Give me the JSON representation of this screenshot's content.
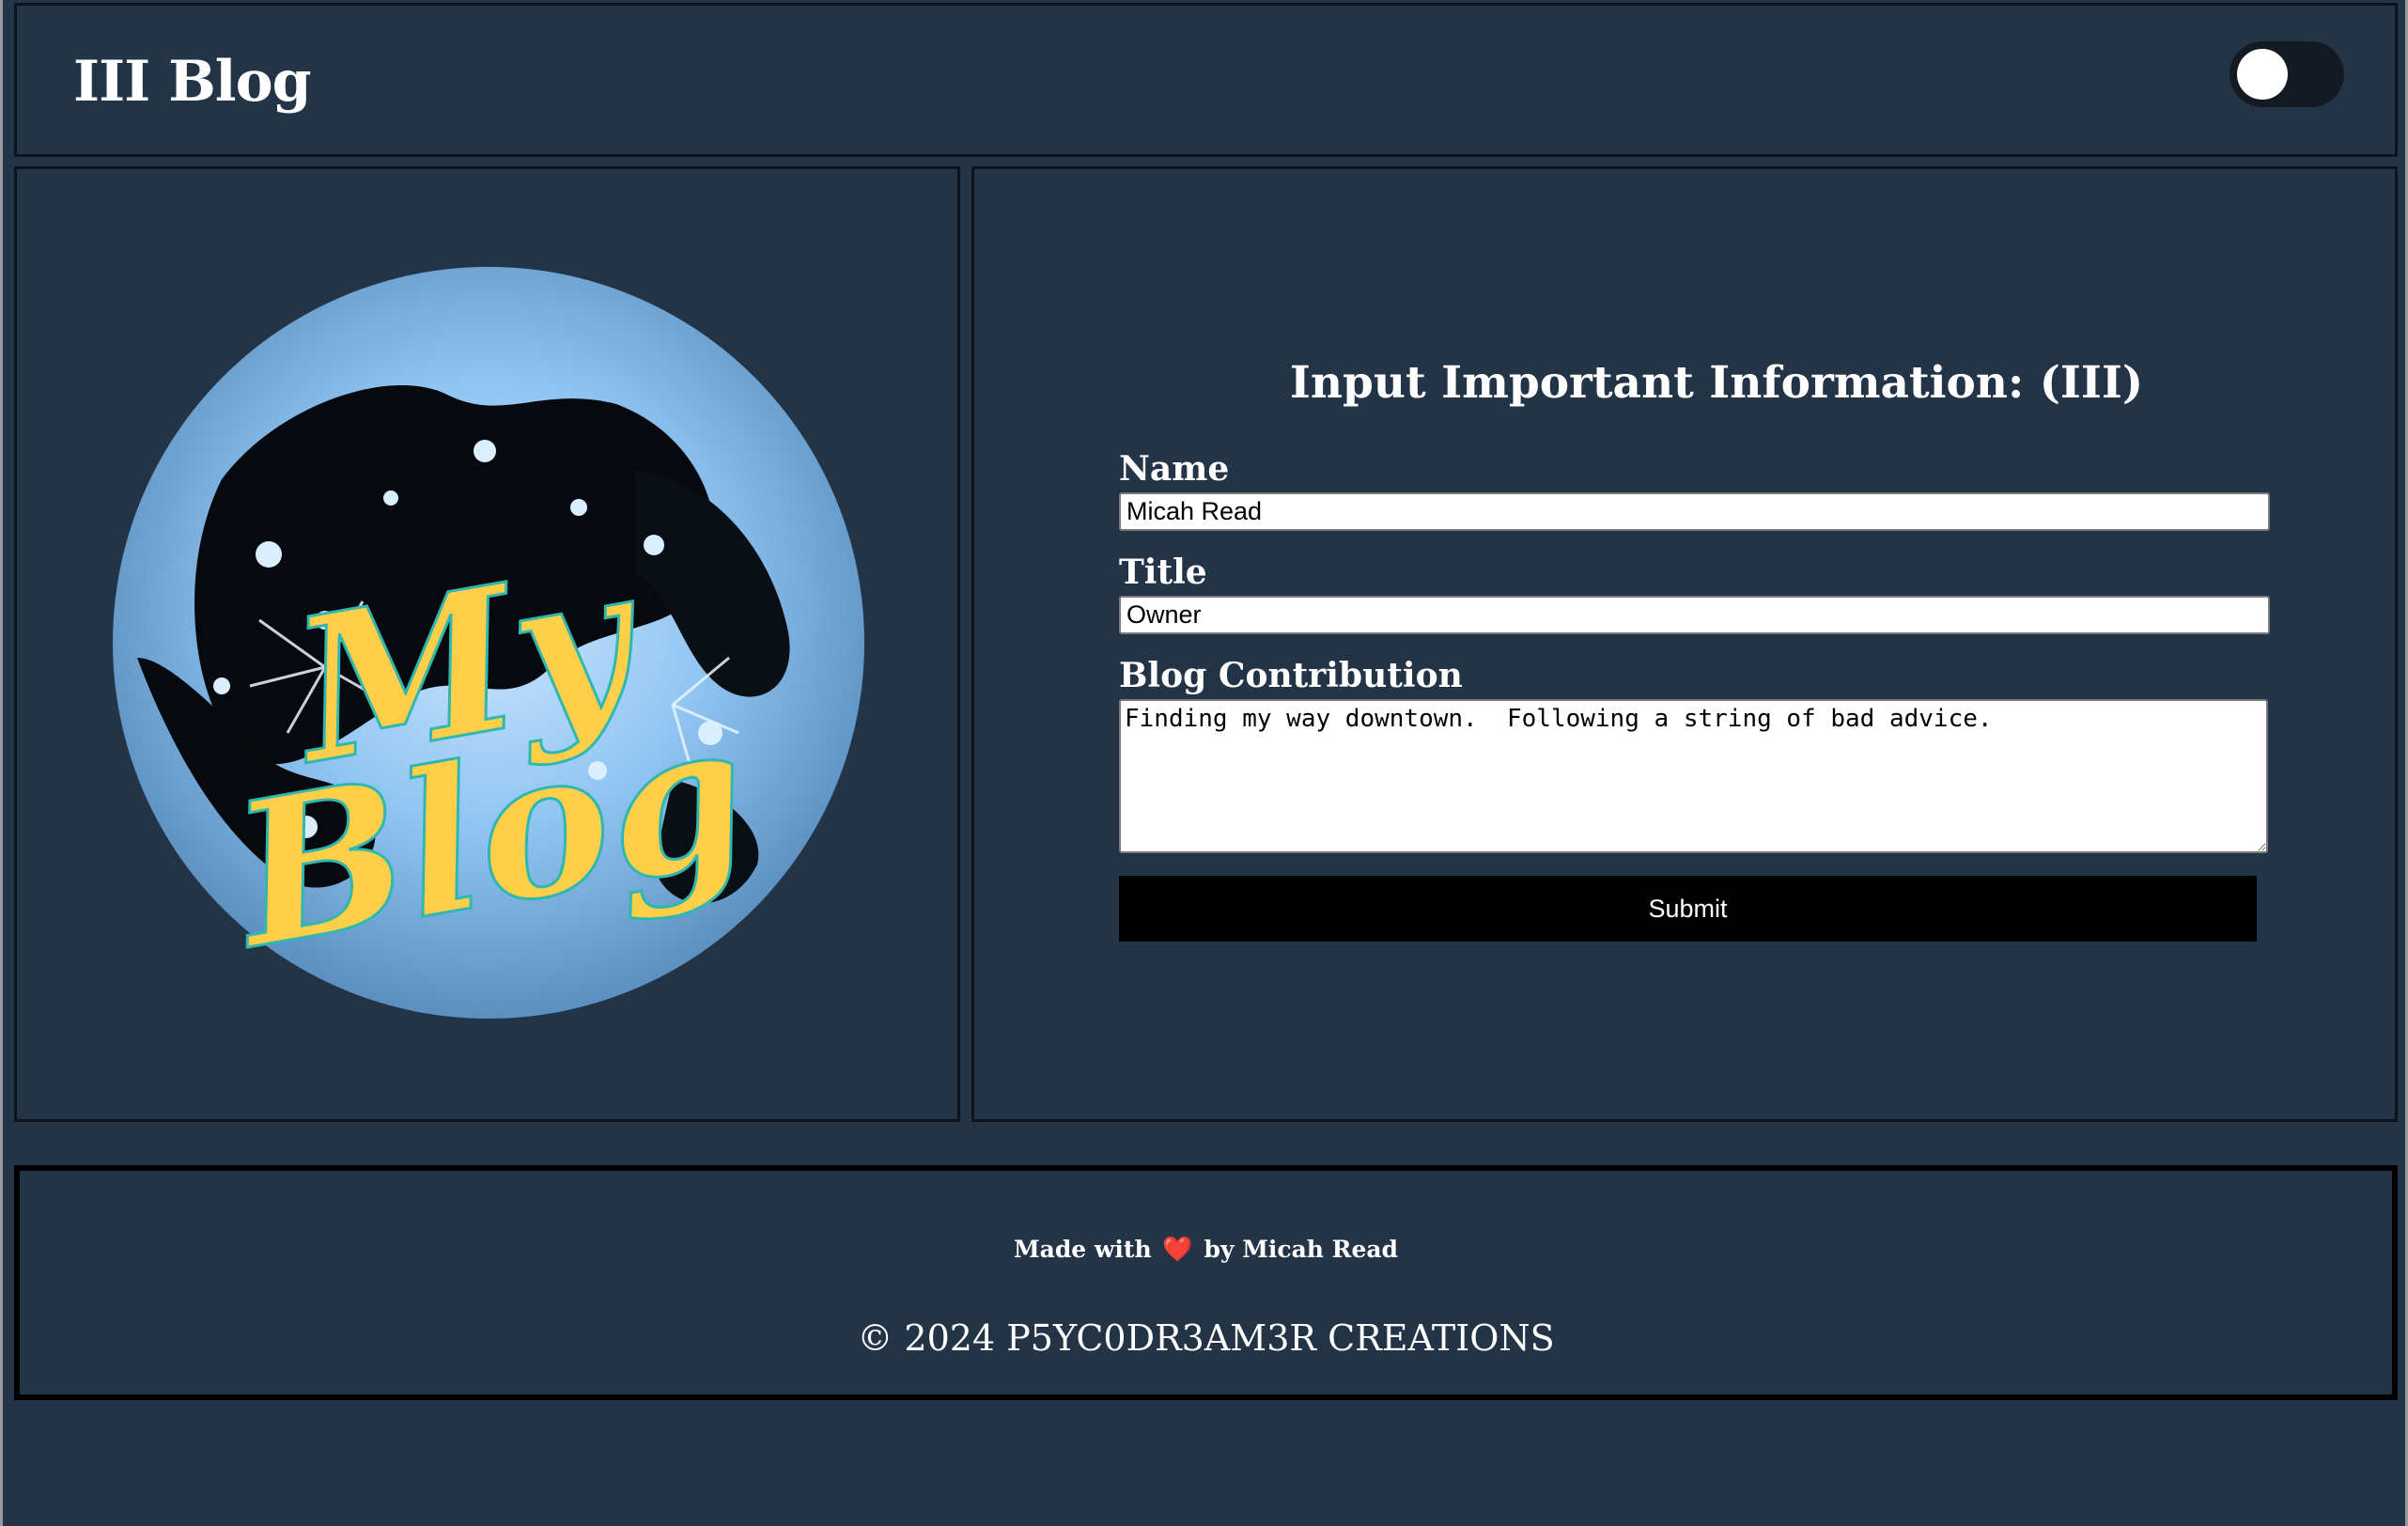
{
  "header": {
    "title": "III Blog",
    "theme_toggle": {
      "state": "off"
    }
  },
  "logo": {
    "text_line1": "My",
    "text_line2": "Blog",
    "colors": {
      "moon_light": "#9fd0ff",
      "moon_dark": "#05080c",
      "lettering": "#ffcf4a",
      "outline": "#2fb7b0"
    }
  },
  "form": {
    "heading": "Input Important Information: (III)",
    "name": {
      "label": "Name",
      "value": "Micah Read"
    },
    "title": {
      "label": "Title",
      "value": "Owner"
    },
    "contribution": {
      "label": "Blog Contribution",
      "value": "Finding my way downtown.  Following a string of bad advice."
    },
    "submit_label": "Submit"
  },
  "footer": {
    "made_with_prefix": "Made with",
    "heart_glyph": "❤️",
    "made_with_suffix": "by Micah Read",
    "copyright": "© 2024 P5YC0DR3AM3R CREATIONS"
  },
  "colors": {
    "background": "#243447",
    "border": "#0d131b",
    "button": "#000000"
  }
}
